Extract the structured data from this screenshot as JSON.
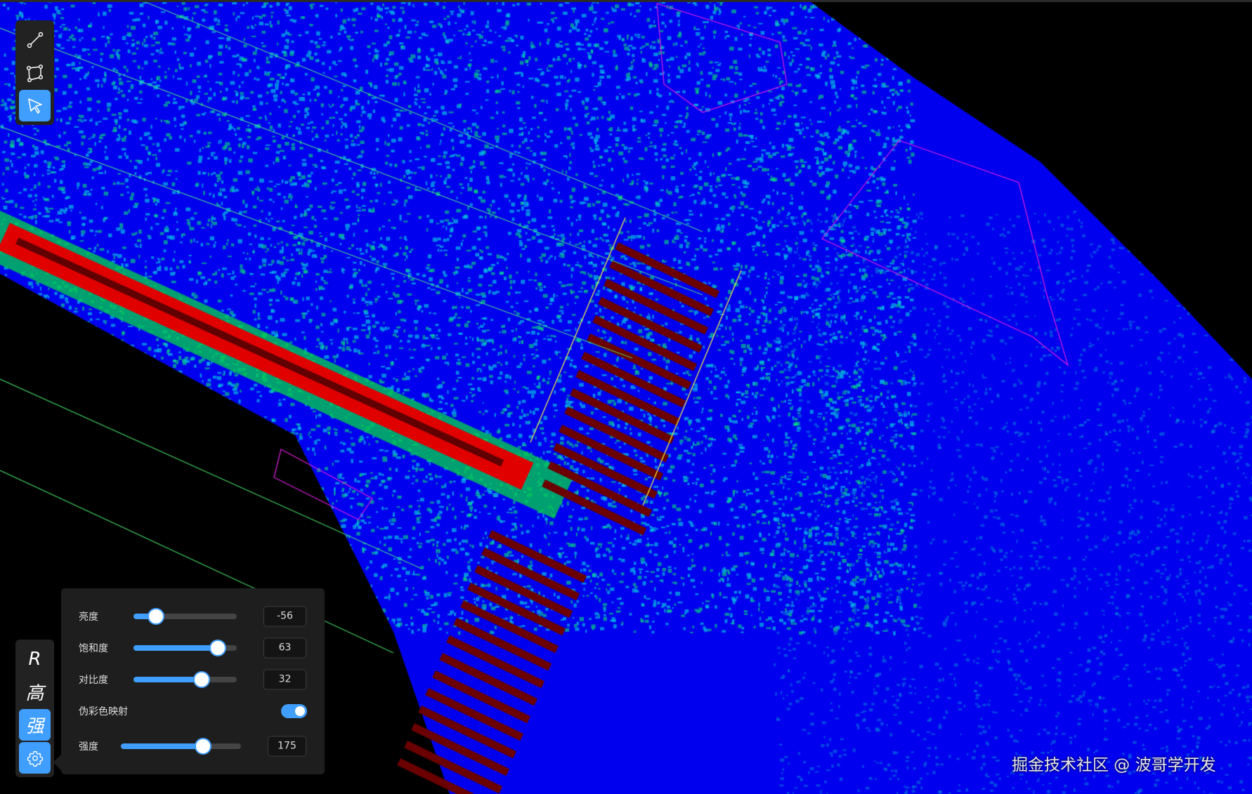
{
  "toolbar": {
    "tools": [
      {
        "name": "line-tool",
        "icon": "line-segment-icon",
        "active": false
      },
      {
        "name": "polygon-tool",
        "icon": "polygon-icon",
        "active": false
      },
      {
        "name": "select-tool",
        "icon": "cursor-arrow-icon",
        "active": true
      }
    ]
  },
  "modes": {
    "items": [
      {
        "label": "R",
        "active": false
      },
      {
        "label": "高",
        "active": false
      },
      {
        "label": "强",
        "active": true
      }
    ],
    "settings_icon": "gear-icon"
  },
  "panel": {
    "brightness": {
      "label": "亮度",
      "value": "-56",
      "fraction": 0.22
    },
    "saturation": {
      "label": "饱和度",
      "value": "63",
      "fraction": 0.815
    },
    "contrast": {
      "label": "对比度",
      "value": "32",
      "fraction": 0.66
    },
    "pseudo_color": {
      "label": "伪彩色映射",
      "on": true
    },
    "intensity": {
      "label": "强度",
      "value": "175",
      "fraction": 0.686
    }
  },
  "watermark": "掘金技术社区 @ 波哥学开发",
  "colors": {
    "accent": "#409eff",
    "panel": "#1e1e1e",
    "cloud_blue": "#0000ff"
  }
}
